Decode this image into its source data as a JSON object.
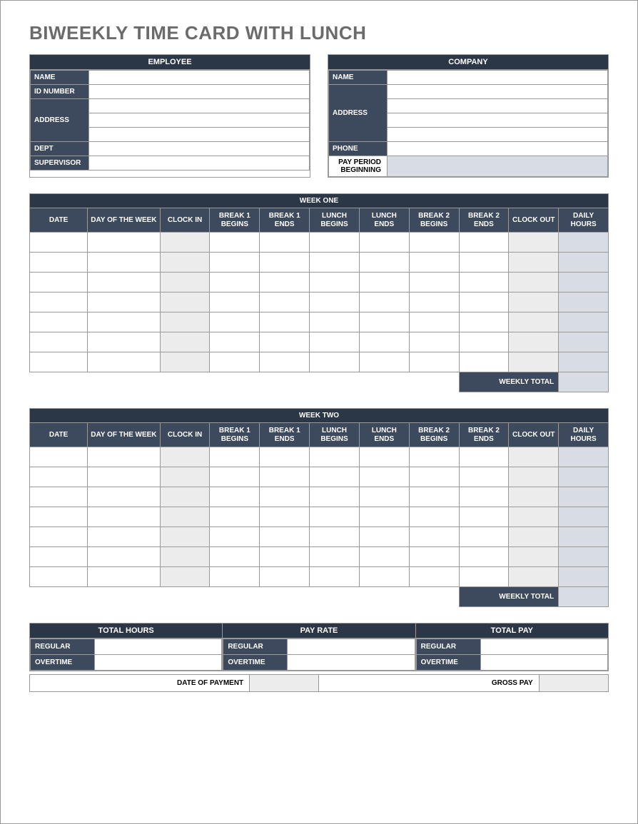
{
  "title": "BIWEEKLY TIME CARD WITH LUNCH",
  "employee": {
    "header": "EMPLOYEE",
    "name_label": "NAME",
    "id_label": "ID NUMBER",
    "address_label": "ADDRESS",
    "dept_label": "DEPT",
    "supervisor_label": "SUPERVISOR",
    "name": "",
    "id": "",
    "addr1": "",
    "addr2": "",
    "addr3": "",
    "dept": "",
    "supervisor": ""
  },
  "company": {
    "header": "COMPANY",
    "name_label": "NAME",
    "address_label": "ADDRESS",
    "phone_label": "PHONE",
    "ppb_label": "PAY PERIOD BEGINNING",
    "name": "",
    "addr1": "",
    "addr2": "",
    "addr3": "",
    "addr4": "",
    "phone": "",
    "ppb": ""
  },
  "columns": {
    "date": "DATE",
    "dow": "DAY OF THE WEEK",
    "clock_in": "CLOCK IN",
    "b1b": "BREAK 1 BEGINS",
    "b1e": "BREAK 1 ENDS",
    "lb": "LUNCH BEGINS",
    "le": "LUNCH ENDS",
    "b2b": "BREAK 2 BEGINS",
    "b2e": "BREAK 2 ENDS",
    "clock_out": "CLOCK OUT",
    "daily": "DAILY HOURS"
  },
  "week1": {
    "title": "WEEK ONE",
    "weekly_total_label": "WEEKLY TOTAL",
    "weekly_total": ""
  },
  "week2": {
    "title": "WEEK TWO",
    "weekly_total_label": "WEEKLY TOTAL",
    "weekly_total": ""
  },
  "summary": {
    "total_hours_header": "TOTAL HOURS",
    "pay_rate_header": "PAY RATE",
    "total_pay_header": "TOTAL PAY",
    "regular_label": "REGULAR",
    "overtime_label": "OVERTIME",
    "hours_regular": "",
    "hours_overtime": "",
    "rate_regular": "",
    "rate_overtime": "",
    "pay_regular": "",
    "pay_overtime": "",
    "date_of_payment_label": "DATE OF PAYMENT",
    "gross_pay_label": "GROSS PAY",
    "date_of_payment": "",
    "gross_pay": ""
  }
}
